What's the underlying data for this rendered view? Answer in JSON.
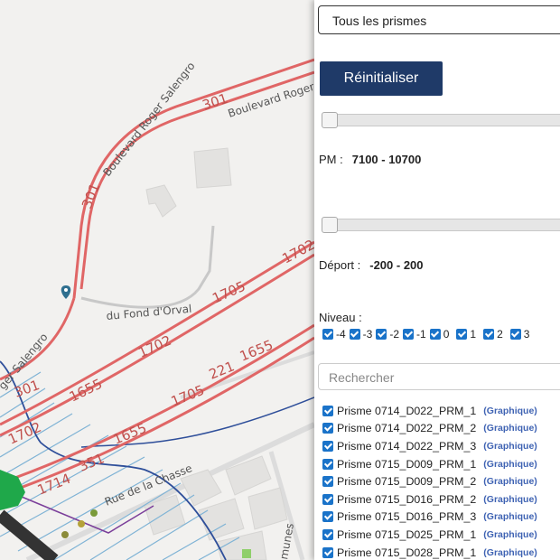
{
  "map": {
    "road_labels": [
      "301",
      "301",
      "301",
      "1702",
      "1702",
      "1702",
      "1705",
      "1705",
      "221",
      "1655",
      "1655",
      "1655",
      "1714",
      "351"
    ],
    "street_labels": [
      "Boulevard Roger Salengro",
      "Boulevard Roger",
      "du Fond d'Orval",
      "ger Salengro",
      "Rue de la Chasse",
      "munes"
    ]
  },
  "panel": {
    "prism_select_value": "Tous les prismes",
    "reset_label": "Réinitialiser",
    "pm_label": "PM :",
    "pm_range": "7100 - 10700",
    "deport_label": "Déport :",
    "deport_range": "-200 - 200",
    "niveau_label": "Niveau :",
    "levels": [
      "-4",
      "-3",
      "-2",
      "-1",
      "0",
      "1",
      "2",
      "3"
    ],
    "search_placeholder": "Rechercher",
    "graph_link_label": "(Graphique)",
    "prisms": [
      "Prisme 0714_D022_PRM_1",
      "Prisme 0714_D022_PRM_2",
      "Prisme 0714_D022_PRM_3",
      "Prisme 0715_D009_PRM_1",
      "Prisme 0715_D009_PRM_2",
      "Prisme 0715_D016_PRM_2",
      "Prisme 0715_D016_PRM_3",
      "Prisme 0715_D025_PRM_1",
      "Prisme 0715_D028_PRM_1"
    ]
  }
}
